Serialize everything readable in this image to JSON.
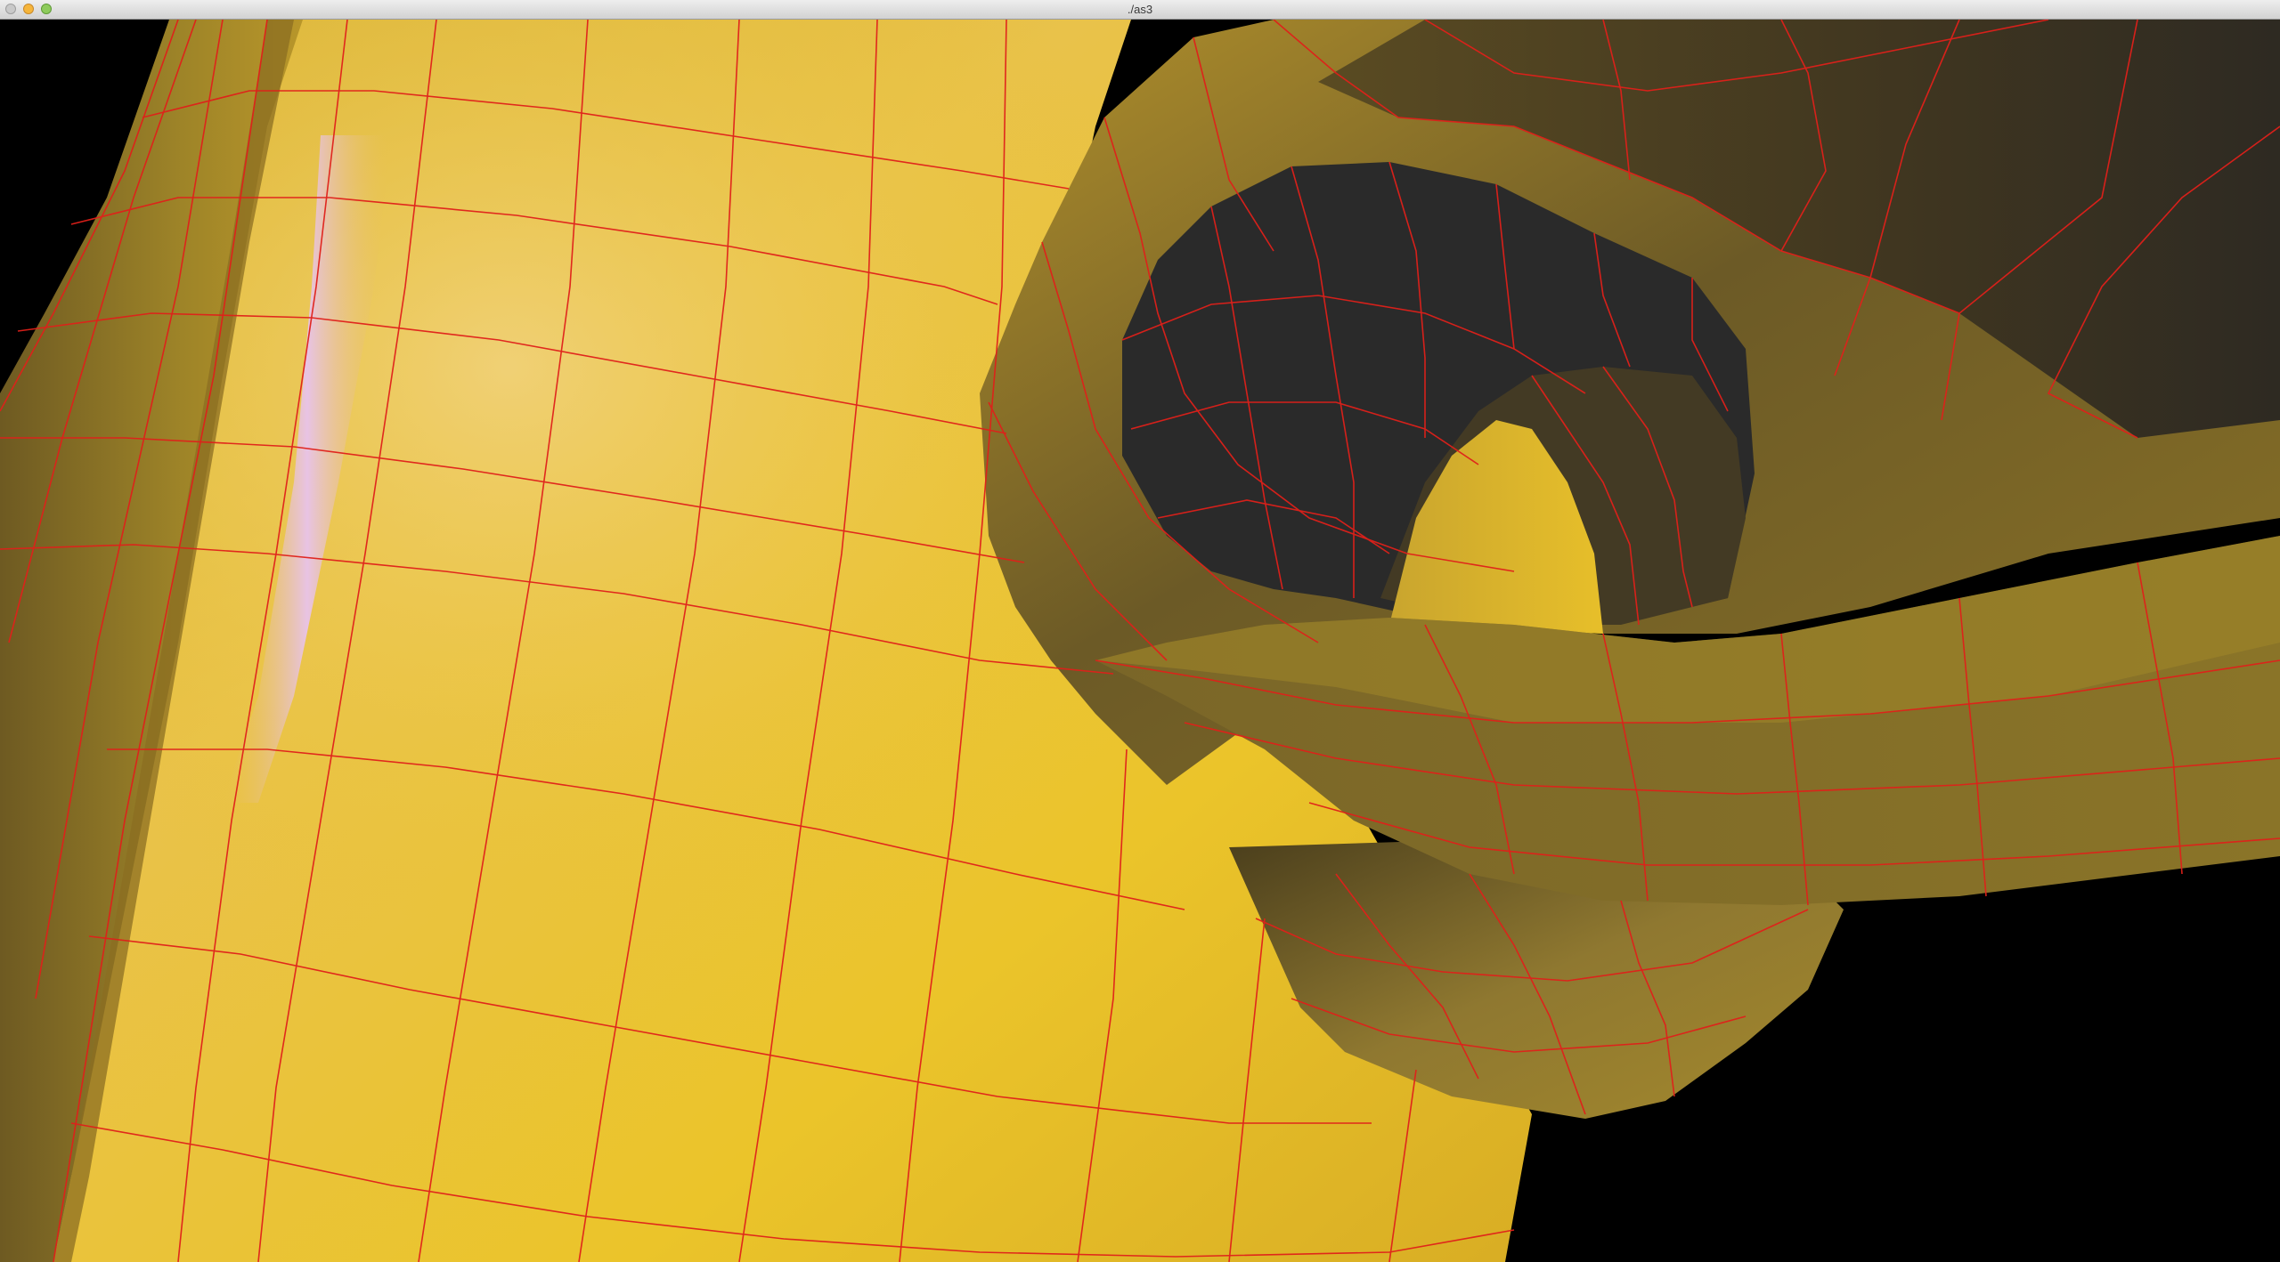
{
  "window": {
    "title": "./as3"
  },
  "viewport": {
    "background_color": "#000000",
    "surface_color": "#e8c22a",
    "shadow_color": "#2a2a2a",
    "wireframe_color": "#e0201a",
    "highlight_color": "#e6c6e8"
  },
  "icons": {
    "close": "close-button-icon",
    "minimize": "minimize-button-icon",
    "maximize": "zoom-button-icon"
  }
}
